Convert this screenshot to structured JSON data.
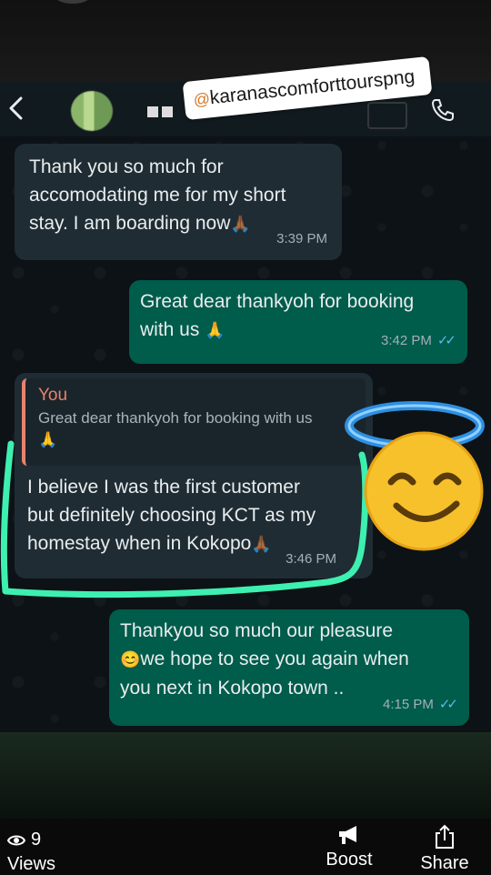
{
  "header": {
    "handle": "karanascomforttourspng",
    "handle_prefix": "@"
  },
  "messages": [
    {
      "id": "m1",
      "direction": "incoming",
      "lines": [
        "Thank you so much for",
        "accomodating me for my short",
        "stay. I am boarding now"
      ],
      "emoji": "🙏🏾",
      "time": "3:39 PM"
    },
    {
      "id": "m2",
      "direction": "outgoing",
      "lines": [
        "Great dear thankyoh for booking",
        "with us"
      ],
      "emoji": "🙏",
      "time": "3:42 PM",
      "read": true
    },
    {
      "id": "m3",
      "direction": "incoming",
      "quote_author": "You",
      "quote_text": "Great dear thankyoh for booking with us",
      "quote_emoji": "🙏",
      "lines": [
        "I believe I was the first customer",
        "but definitely choosing KCT as my",
        "homestay when in Kokopo"
      ],
      "emoji": "🙏🏾",
      "time": "3:46 PM"
    },
    {
      "id": "m4",
      "direction": "outgoing",
      "lines": [
        "Thankyou so much our pleasure",
        "we hope to see you again when",
        "you next in Kokopo town .."
      ],
      "emoji": "😊",
      "time": "4:15 PM",
      "read": true
    }
  ],
  "footer": {
    "views_count": "9",
    "views_label": "Views",
    "boost_label": "Boost",
    "share_label": "Share"
  },
  "colors": {
    "incoming_bubble": "#1f2c33",
    "outgoing_bubble": "#005c4b",
    "highlight_stroke": "#3ef0b0",
    "quote_accent": "#e8826e",
    "read_ticks": "#53bdeb"
  },
  "icons": {
    "back": "chevron-left-icon",
    "call": "phone-icon",
    "views": "eye-icon",
    "boost": "megaphone-icon",
    "share": "share-icon",
    "sticker": "halo-smile-emoji"
  }
}
